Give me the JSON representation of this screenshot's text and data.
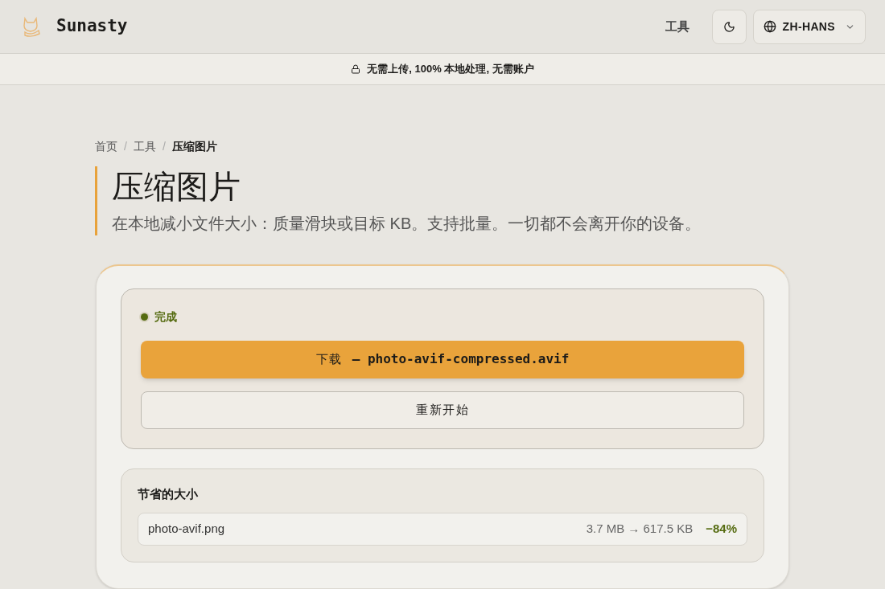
{
  "header": {
    "brand": "Sunasty",
    "nav_link": "工具",
    "language": "ZH-HANS"
  },
  "banner": "无需上传, 100% 本地处理, 无需账户",
  "breadcrumb_separator": "/",
  "breadcrumb": [
    {
      "label": "首页",
      "current": false
    },
    {
      "label": "工具",
      "current": false
    },
    {
      "label": "压缩图片",
      "current": true
    }
  ],
  "title": "压缩图片",
  "subtitle": "在本地减小文件大小：质量滑块或目标 KB。支持批量。一切都不会离开你的设备。",
  "result": {
    "status": "完成",
    "download_label": "下载",
    "download_file": "— photo-avif-compressed.avif",
    "restart": "重新开始"
  },
  "savings": {
    "title": "节省的大小",
    "rows": [
      {
        "file": "photo-avif.png",
        "sizes": "3.7 MB → 617.5 KB",
        "change": "−84%"
      }
    ]
  }
}
